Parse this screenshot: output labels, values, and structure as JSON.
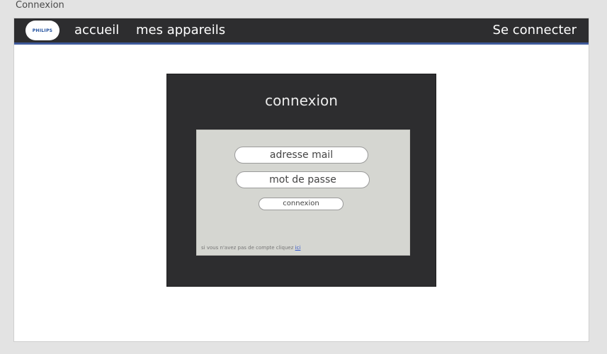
{
  "window": {
    "title": "Connexion"
  },
  "navbar": {
    "logo_text": "PHILIPS",
    "links": {
      "home": "accueil",
      "devices": "mes appareils",
      "login": "Se connecter"
    },
    "colors": {
      "background": "#2d2d2f",
      "underline": "#3e5a9a"
    }
  },
  "login_panel": {
    "title": "connexion",
    "email_placeholder": "adresse mail",
    "password_placeholder": "mot de passe",
    "submit_label": "connexion",
    "signup_text": "si vous n'avez pas de compte cliquez ",
    "signup_link": "ici"
  }
}
